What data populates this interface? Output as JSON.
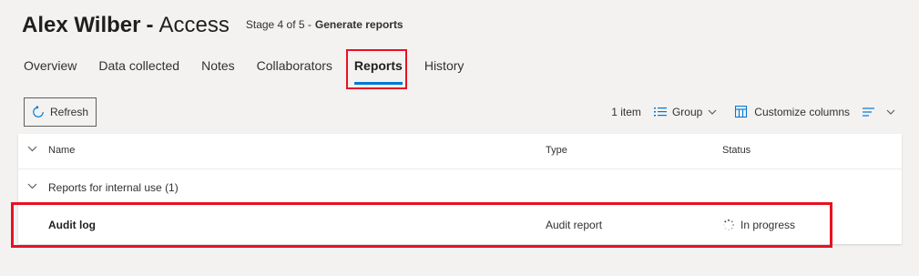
{
  "header": {
    "title_name": "Alex Wilber",
    "title_separator": "-",
    "title_section": "Access",
    "stage_prefix": "Stage 4 of 5 -",
    "stage_name": "Generate reports"
  },
  "tabs": [
    {
      "label": "Overview"
    },
    {
      "label": "Data collected"
    },
    {
      "label": "Notes"
    },
    {
      "label": "Collaborators"
    },
    {
      "label": "Reports",
      "active": true
    },
    {
      "label": "History"
    }
  ],
  "toolbar": {
    "refresh_label": "Refresh",
    "item_count": "1 item",
    "group_label": "Group",
    "customize_label": "Customize columns"
  },
  "table": {
    "columns": {
      "name": "Name",
      "type": "Type",
      "status": "Status"
    },
    "group": {
      "label": "Reports for internal use (1)"
    },
    "rows": [
      {
        "name": "Audit log",
        "type": "Audit report",
        "status": "In progress"
      }
    ]
  },
  "colors": {
    "accent": "#0078d4",
    "highlight": "#e81123",
    "background": "#f3f2f1"
  },
  "icons": [
    "refresh-icon",
    "group-icon",
    "chevron-down-icon",
    "customize-columns-icon",
    "view-options-icon",
    "spinner-icon"
  ]
}
